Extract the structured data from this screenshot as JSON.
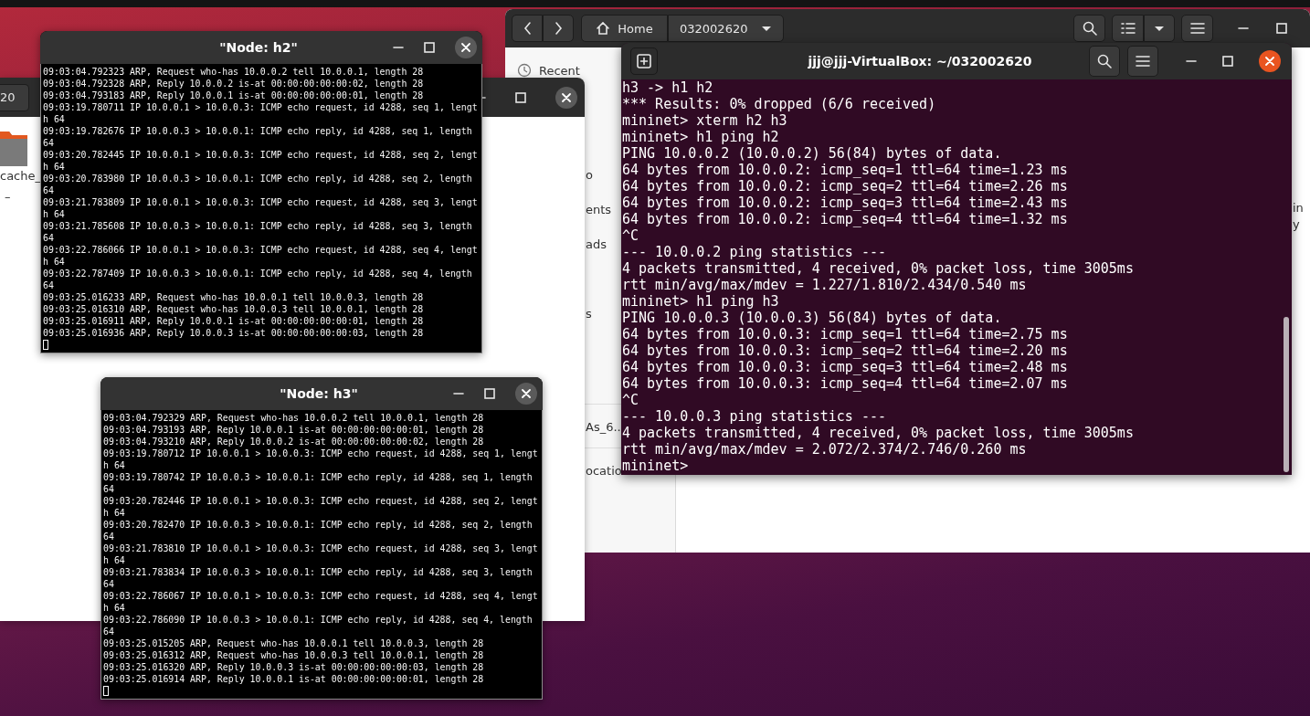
{
  "file_manager_back": {
    "path": [
      {
        "label": "Home",
        "kind": "home"
      },
      {
        "label": "032002620",
        "kind": "folder"
      }
    ],
    "sidebar": [
      "Recent",
      "o",
      "ents",
      "ads",
      "s",
      "As_6..",
      "ocatio"
    ],
    "file_fragments": [
      "in",
      "y"
    ]
  },
  "file_manager_front": {
    "path_fragment": "20",
    "file_name": "cache_",
    "file_sub": "–"
  },
  "xterm_windows": [
    {
      "title": "\"Node: h2\"",
      "lines": [
        "09:03:04.792323 ARP, Request who-has 10.0.0.2 tell 10.0.0.1, length 28",
        "09:03:04.792328 ARP, Reply 10.0.0.2 is-at 00:00:00:00:00:02, length 28",
        "09:03:04.793183 ARP, Reply 10.0.0.1 is-at 00:00:00:00:00:01, length 28",
        "09:03:19.780711 IP 10.0.0.1 > 10.0.0.3: ICMP echo request, id 4288, seq 1, lengt",
        "h 64",
        "09:03:19.782676 IP 10.0.0.3 > 10.0.0.1: ICMP echo reply, id 4288, seq 1, length",
        "64",
        "09:03:20.782445 IP 10.0.0.1 > 10.0.0.3: ICMP echo request, id 4288, seq 2, lengt",
        "h 64",
        "09:03:20.783980 IP 10.0.0.3 > 10.0.0.1: ICMP echo reply, id 4288, seq 2, length",
        "64",
        "09:03:21.783809 IP 10.0.0.1 > 10.0.0.3: ICMP echo request, id 4288, seq 3, lengt",
        "h 64",
        "09:03:21.785608 IP 10.0.0.3 > 10.0.0.1: ICMP echo reply, id 4288, seq 3, length",
        "64",
        "09:03:22.786066 IP 10.0.0.1 > 10.0.0.3: ICMP echo request, id 4288, seq 4, lengt",
        "h 64",
        "09:03:22.787409 IP 10.0.0.3 > 10.0.0.1: ICMP echo reply, id 4288, seq 4, length",
        "64",
        "09:03:25.016233 ARP, Request who-has 10.0.0.1 tell 10.0.0.3, length 28",
        "09:03:25.016310 ARP, Request who-has 10.0.0.3 tell 10.0.0.1, length 28",
        "09:03:25.016911 ARP, Reply 10.0.0.1 is-at 00:00:00:00:00:01, length 28",
        "09:03:25.016936 ARP, Reply 10.0.0.3 is-at 00:00:00:00:00:03, length 28"
      ]
    },
    {
      "title": "\"Node: h3\"",
      "lines": [
        "09:03:04.792329 ARP, Request who-has 10.0.0.2 tell 10.0.0.1, length 28",
        "09:03:04.793193 ARP, Reply 10.0.0.1 is-at 00:00:00:00:00:01, length 28",
        "09:03:04.793210 ARP, Reply 10.0.0.2 is-at 00:00:00:00:00:02, length 28",
        "09:03:19.780712 IP 10.0.0.1 > 10.0.0.3: ICMP echo request, id 4288, seq 1, lengt",
        "h 64",
        "09:03:19.780742 IP 10.0.0.3 > 10.0.0.1: ICMP echo reply, id 4288, seq 1, length",
        "64",
        "09:03:20.782446 IP 10.0.0.1 > 10.0.0.3: ICMP echo request, id 4288, seq 2, lengt",
        "h 64",
        "09:03:20.782470 IP 10.0.0.3 > 10.0.0.1: ICMP echo reply, id 4288, seq 2, length",
        "64",
        "09:03:21.783810 IP 10.0.0.1 > 10.0.0.3: ICMP echo request, id 4288, seq 3, lengt",
        "h 64",
        "09:03:21.783834 IP 10.0.0.3 > 10.0.0.1: ICMP echo reply, id 4288, seq 3, length",
        "64",
        "09:03:22.786067 IP 10.0.0.1 > 10.0.0.3: ICMP echo request, id 4288, seq 4, lengt",
        "h 64",
        "09:03:22.786090 IP 10.0.0.3 > 10.0.0.1: ICMP echo reply, id 4288, seq 4, length",
        "64",
        "09:03:25.015205 ARP, Request who-has 10.0.0.1 tell 10.0.0.3, length 28",
        "09:03:25.016312 ARP, Request who-has 10.0.0.3 tell 10.0.0.1, length 28",
        "09:03:25.016320 ARP, Reply 10.0.0.3 is-at 00:00:00:00:00:03, length 28",
        "09:03:25.016914 ARP, Reply 10.0.0.1 is-at 00:00:00:00:00:01, length 28"
      ]
    }
  ],
  "terminal": {
    "title": "jjj@jjj-VirtualBox: ~/032002620",
    "lines": [
      "h3 -> h1 h2",
      "*** Results: 0% dropped (6/6 received)",
      "mininet> xterm h2 h3",
      "mininet> h1 ping h2",
      "PING 10.0.0.2 (10.0.0.2) 56(84) bytes of data.",
      "64 bytes from 10.0.0.2: icmp_seq=1 ttl=64 time=1.23 ms",
      "64 bytes from 10.0.0.2: icmp_seq=2 ttl=64 time=2.26 ms",
      "64 bytes from 10.0.0.2: icmp_seq=3 ttl=64 time=2.43 ms",
      "64 bytes from 10.0.0.2: icmp_seq=4 ttl=64 time=1.32 ms",
      "^C",
      "--- 10.0.0.2 ping statistics ---",
      "4 packets transmitted, 4 received, 0% packet loss, time 3005ms",
      "rtt min/avg/max/mdev = 1.227/1.810/2.434/0.540 ms",
      "mininet> h1 ping h3",
      "PING 10.0.0.3 (10.0.0.3) 56(84) bytes of data.",
      "64 bytes from 10.0.0.3: icmp_seq=1 ttl=64 time=2.75 ms",
      "64 bytes from 10.0.0.3: icmp_seq=2 ttl=64 time=2.20 ms",
      "64 bytes from 10.0.0.3: icmp_seq=3 ttl=64 time=2.48 ms",
      "64 bytes from 10.0.0.3: icmp_seq=4 ttl=64 time=2.07 ms",
      "^C",
      "--- 10.0.0.3 ping statistics ---",
      "4 packets transmitted, 4 received, 0% packet loss, time 3005ms",
      "rtt min/avg/max/mdev = 2.072/2.374/2.746/0.260 ms",
      "mininet>"
    ]
  }
}
